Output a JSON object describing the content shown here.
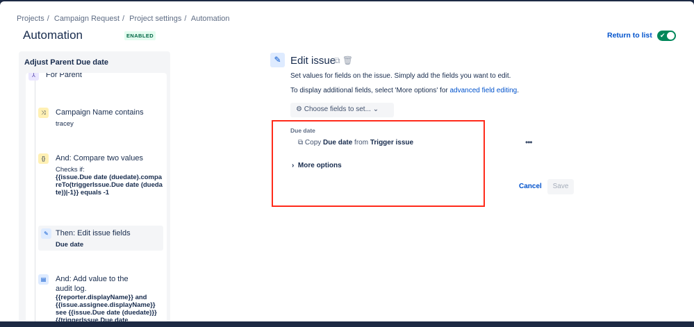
{
  "breadcrumbs": [
    "Projects",
    "Campaign Request",
    "Project settings",
    "Automation"
  ],
  "page_title": "Automation",
  "status_badge": "ENABLED",
  "return_link": "Return to list",
  "toggle_on": true,
  "rule": {
    "title": "Adjust Parent Due date",
    "items": [
      {
        "label": "For Parent",
        "icon": "branch-icon"
      },
      {
        "label": "Campaign Name contains",
        "detail": "tracey",
        "icon": "shuffle-icon"
      },
      {
        "label": "And: Compare two values",
        "detail_prefix": "Checks if:",
        "detail": "{{issue.Due date (duedate).compareTo(triggerIssue.Due date (duedate))|-1}} equals -1",
        "icon": "braces-icon"
      },
      {
        "label": "Then: Edit issue fields",
        "detail": "Due date",
        "icon": "pencil-icon"
      },
      {
        "label": "And: Add value to the audit log.",
        "detail": "{{reporter.displayName}} and {{issue.assignee.displayName}} see {{issue.Due date (duedate)}} {{triggerIssue.Due date",
        "icon": "log-icon"
      }
    ]
  },
  "editor": {
    "title": "Edit issue",
    "desc1": "Set values for fields on the issue. Simply add the fields you want to edit.",
    "desc2": "To display additional fields, select 'More options' for ",
    "desc2_link": "advanced field editing",
    "desc2_end": ".",
    "choose_label": "Choose fields to set...",
    "field_label": "Due date",
    "copy_pre": "Copy ",
    "copy_field": "Due date",
    "copy_mid": " from ",
    "copy_source": "Trigger issue",
    "more_options": "More options",
    "cancel": "Cancel",
    "save": "Save"
  }
}
